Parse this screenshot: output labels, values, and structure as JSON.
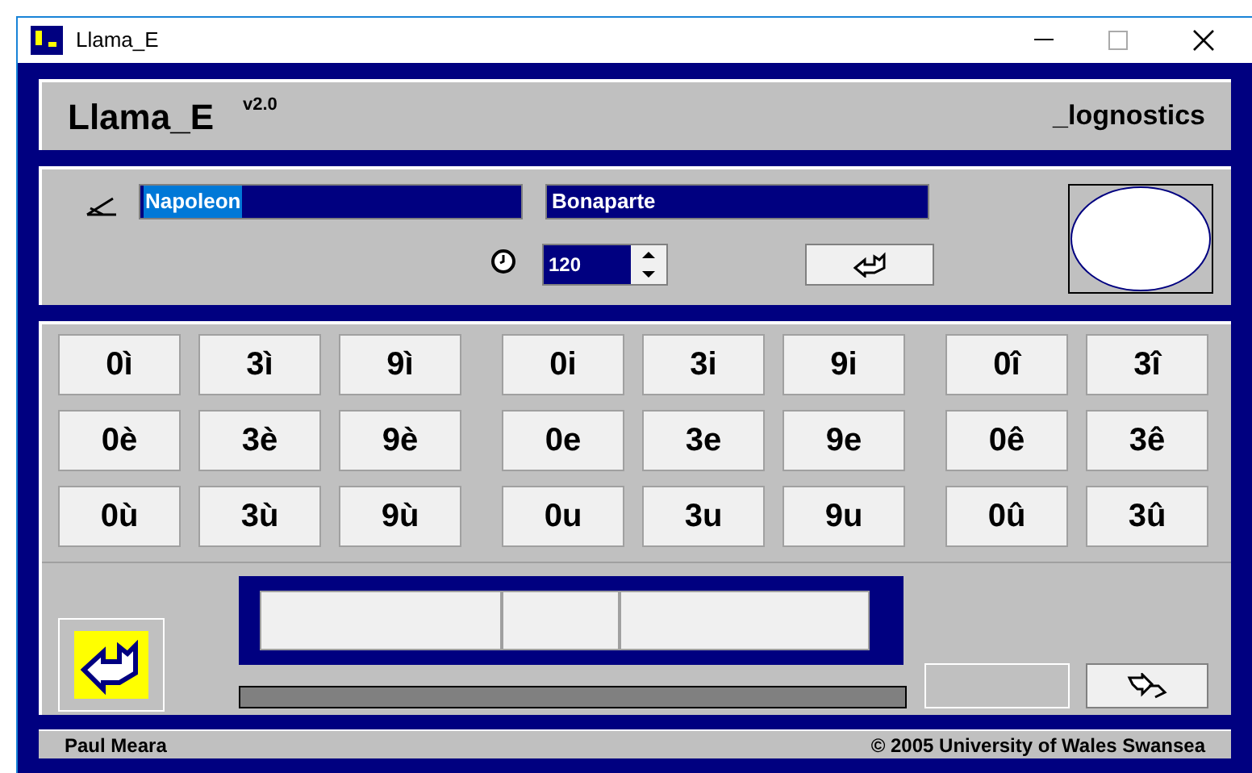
{
  "window": {
    "title": "Llama_E"
  },
  "header": {
    "title": "Llama_E",
    "version": "v2.0",
    "module": "_lognostics"
  },
  "form": {
    "first_name": "Napoleon",
    "last_name": "Bonaparte",
    "time": "120"
  },
  "stimulus_buttons": [
    [
      "0ì",
      "3ì",
      "9ì",
      "0i",
      "3i",
      "9i",
      "0î",
      "3î"
    ],
    [
      "0è",
      "3è",
      "9è",
      "0e",
      "3e",
      "9e",
      "0ê",
      "3ê"
    ],
    [
      "0ù",
      "3ù",
      "9ù",
      "0u",
      "3u",
      "9u",
      "0û",
      "3û"
    ]
  ],
  "footer": {
    "author": "Paul Meara",
    "copyright": "© 2005 University of Wales Swansea"
  }
}
